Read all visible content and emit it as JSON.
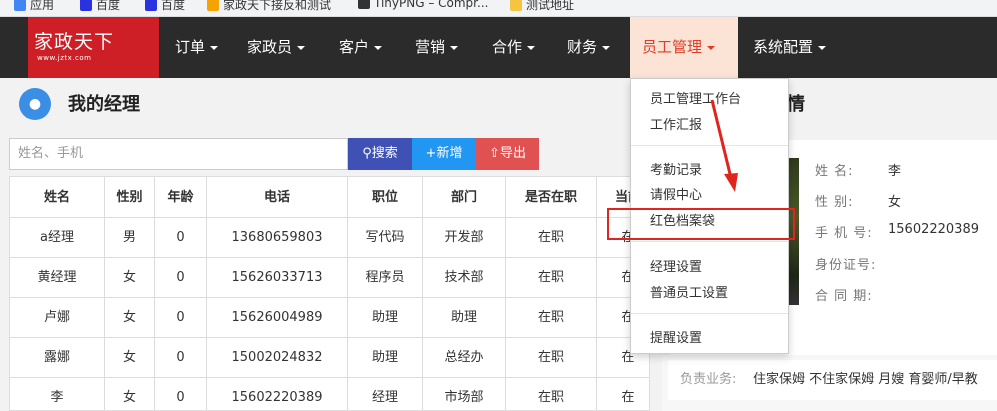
{
  "bookmarks": [
    {
      "label": "应用",
      "icon": "apps-icon",
      "color": "#4285f4"
    },
    {
      "label": "百度",
      "icon": "baidu-icon",
      "color": "#2932e1"
    },
    {
      "label": "百度",
      "icon": "baidu-icon",
      "color": "#2932e1"
    },
    {
      "label": "家政天下接反和测试",
      "icon": "bookmark-icon",
      "color": "#f4a300"
    },
    {
      "label": "TinyPNG – Compr...",
      "icon": "panda-icon",
      "color": "#333333"
    },
    {
      "label": "测试地址",
      "icon": "folder-icon",
      "color": "#f4c542"
    }
  ],
  "logo": {
    "title": "家政天下",
    "url": "www.jztx.com"
  },
  "nav": [
    {
      "label": "订单"
    },
    {
      "label": "家政员"
    },
    {
      "label": "客户"
    },
    {
      "label": "营销"
    },
    {
      "label": "合作"
    },
    {
      "label": "财务"
    },
    {
      "label": "员工管理",
      "active": true
    },
    {
      "label": "系统配置"
    }
  ],
  "page": {
    "title": "我的经理",
    "detail_title": "情"
  },
  "search": {
    "placeholder": "姓名、手机",
    "search_label": "搜索",
    "add_label": "新增",
    "export_label": "导出"
  },
  "table": {
    "headers": [
      "姓名",
      "性别",
      "年龄",
      "电话",
      "职位",
      "部门",
      "是否在职",
      "当前"
    ],
    "rows": [
      [
        "a经理",
        "男",
        "0",
        "13680659803",
        "写代码",
        "开发部",
        "在职",
        "在"
      ],
      [
        "黄经理",
        "女",
        "0",
        "15626033713",
        "程序员",
        "技术部",
        "在职",
        "在"
      ],
      [
        "卢娜",
        "女",
        "0",
        "15626004989",
        "助理",
        "助理",
        "在职",
        "在"
      ],
      [
        "露娜",
        "女",
        "0",
        "15002024832",
        "助理",
        "总经办",
        "在职",
        "在"
      ],
      [
        "李",
        "女",
        "0",
        "15602220389",
        "经理",
        "市场部",
        "在职",
        "在"
      ]
    ]
  },
  "dropdown": {
    "groups": [
      [
        "员工管理工作台",
        "工作汇报"
      ],
      [
        "考勤记录",
        "请假中心",
        "红色档案袋"
      ],
      [
        "经理设置",
        "普通员工设置"
      ],
      [
        "提醒设置"
      ]
    ],
    "highlighted": "红色档案袋"
  },
  "detail": {
    "fields": [
      {
        "label": "姓  名:",
        "value": "李"
      },
      {
        "label": "性  别:",
        "value": "女"
      },
      {
        "label": "手 机 号:",
        "value": "15602220389"
      },
      {
        "label": "身份证号:",
        "value": ""
      },
      {
        "label": "合 同 期:",
        "value": ""
      }
    ],
    "responsibility_label": "负责业务:",
    "responsibility_value": "住家保姆 不住家保姆 月嫂 育婴师/早教"
  },
  "colors": {
    "brand": "#cf1f26",
    "navbar": "#2b2b2b",
    "active_bg": "#fbe3d6",
    "active_text": "#e23b27",
    "highlight": "#e0251f"
  }
}
